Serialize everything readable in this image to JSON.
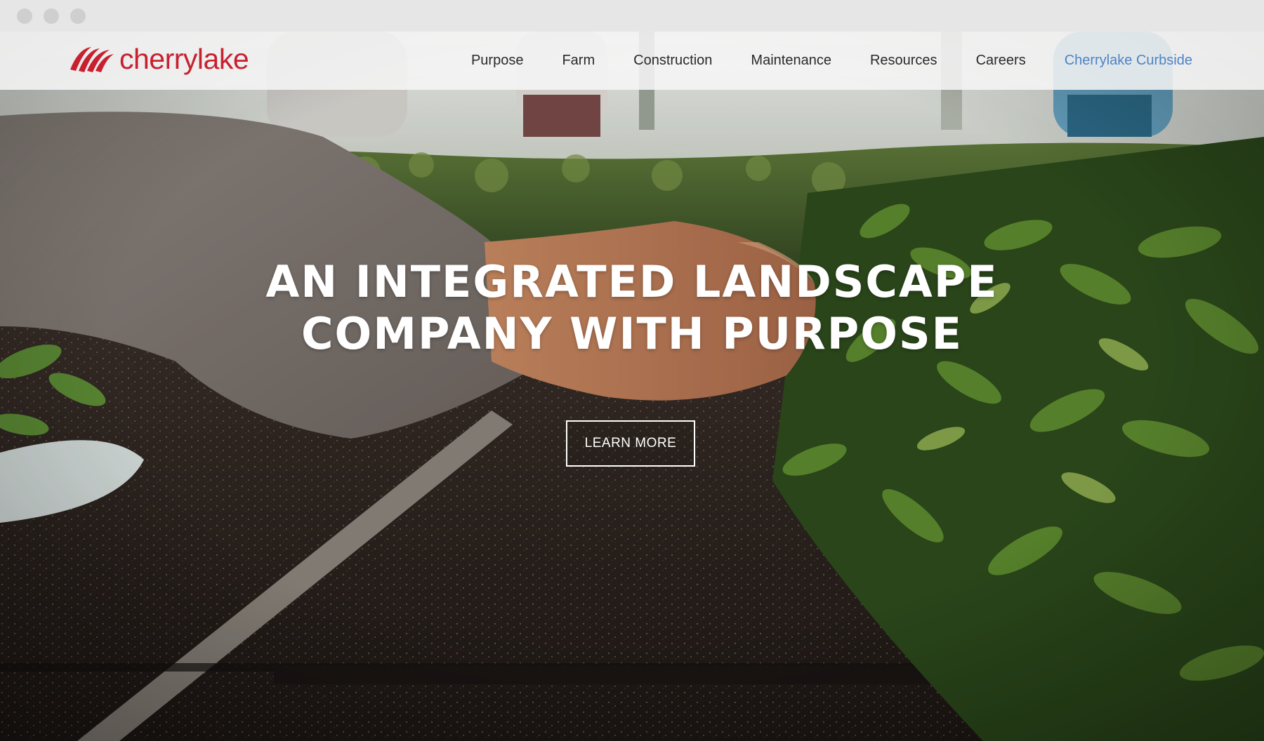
{
  "brand": {
    "name": "cherrylake",
    "logo_icon": "cherrylake-swoosh-icon",
    "color": "#c8202f"
  },
  "nav": {
    "items": [
      {
        "label": "Purpose"
      },
      {
        "label": "Farm"
      },
      {
        "label": "Construction"
      },
      {
        "label": "Maintenance"
      },
      {
        "label": "Resources"
      },
      {
        "label": "Careers"
      },
      {
        "label": "Cherrylake Curbside",
        "color": "#4f83c4"
      }
    ]
  },
  "hero": {
    "title_line1": "AN INTEGRATED LANDSCAPE",
    "title_line2": "COMPANY WITH PURPOSE",
    "cta_label": "LEARN MORE"
  }
}
